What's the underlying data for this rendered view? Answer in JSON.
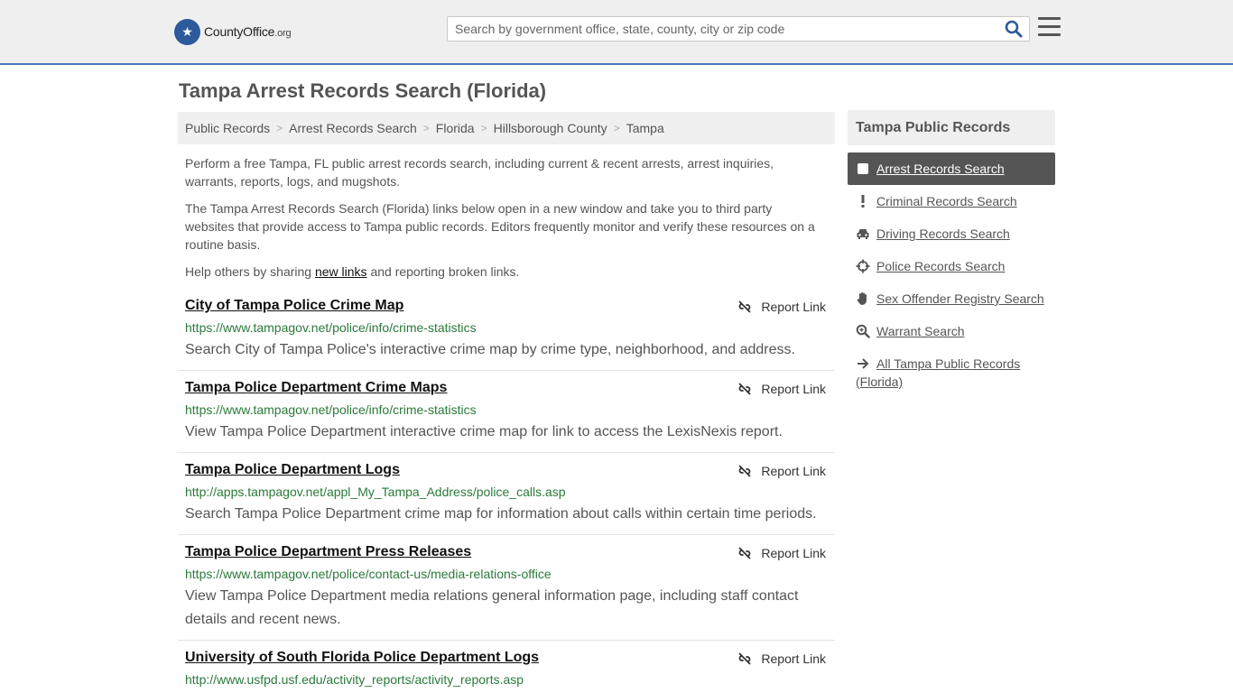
{
  "header": {
    "logo_text": "CountyOffice",
    "logo_suffix": ".org",
    "search_placeholder": "Search by government office, state, county, city or zip code"
  },
  "page_title": "Tampa Arrest Records Search (Florida)",
  "breadcrumb": [
    "Public Records",
    "Arrest Records Search",
    "Florida",
    "Hillsborough County",
    "Tampa"
  ],
  "intro": {
    "p1": "Perform a free Tampa, FL public arrest records search, including current & recent arrests, arrest inquiries, warrants, reports, logs, and mugshots.",
    "p2": "The Tampa Arrest Records Search (Florida) links below open in a new window and take you to third party websites that provide access to Tampa public records. Editors frequently monitor and verify these resources on a routine basis.",
    "p3_before": "Help others by sharing ",
    "p3_link": "new links",
    "p3_after": " and reporting broken links."
  },
  "report_label": "Report Link",
  "results": [
    {
      "title": "City of Tampa Police Crime Map",
      "url": "https://www.tampagov.net/police/info/crime-statistics",
      "desc": "Search City of Tampa Police's interactive crime map by crime type, neighborhood, and address."
    },
    {
      "title": "Tampa Police Department Crime Maps",
      "url": "https://www.tampagov.net/police/info/crime-statistics",
      "desc": "View Tampa Police Department interactive crime map for link to access the LexisNexis report."
    },
    {
      "title": "Tampa Police Department Logs",
      "url": "http://apps.tampagov.net/appl_My_Tampa_Address/police_calls.asp",
      "desc": "Search Tampa Police Department crime map for information about calls within certain time periods."
    },
    {
      "title": "Tampa Police Department Press Releases",
      "url": "https://www.tampagov.net/police/contact-us/media-relations-office",
      "desc": "View Tampa Police Department media relations general information page, including staff contact details and recent news."
    },
    {
      "title": "University of South Florida Police Department Logs",
      "url": "http://www.usfpd.usf.edu/activity_reports/activity_reports.asp",
      "desc": ""
    }
  ],
  "sidebar": {
    "title": "Tampa Public Records",
    "items": [
      {
        "label": "Arrest Records Search",
        "icon": "square-icon"
      },
      {
        "label": "Criminal Records Search",
        "icon": "exclamation-icon"
      },
      {
        "label": "Driving Records Search",
        "icon": "car-icon"
      },
      {
        "label": "Police Records Search",
        "icon": "crosshairs-icon"
      },
      {
        "label": "Sex Offender Registry Search",
        "icon": "hand-icon"
      },
      {
        "label": "Warrant Search",
        "icon": "magnifier-icon"
      },
      {
        "label": "All Tampa Public Records (Florida)",
        "icon": "arrow-right-icon"
      }
    ]
  },
  "colors": {
    "accent": "#4a79b5",
    "url_green": "#2b7a3a",
    "active_bg": "#555555"
  }
}
